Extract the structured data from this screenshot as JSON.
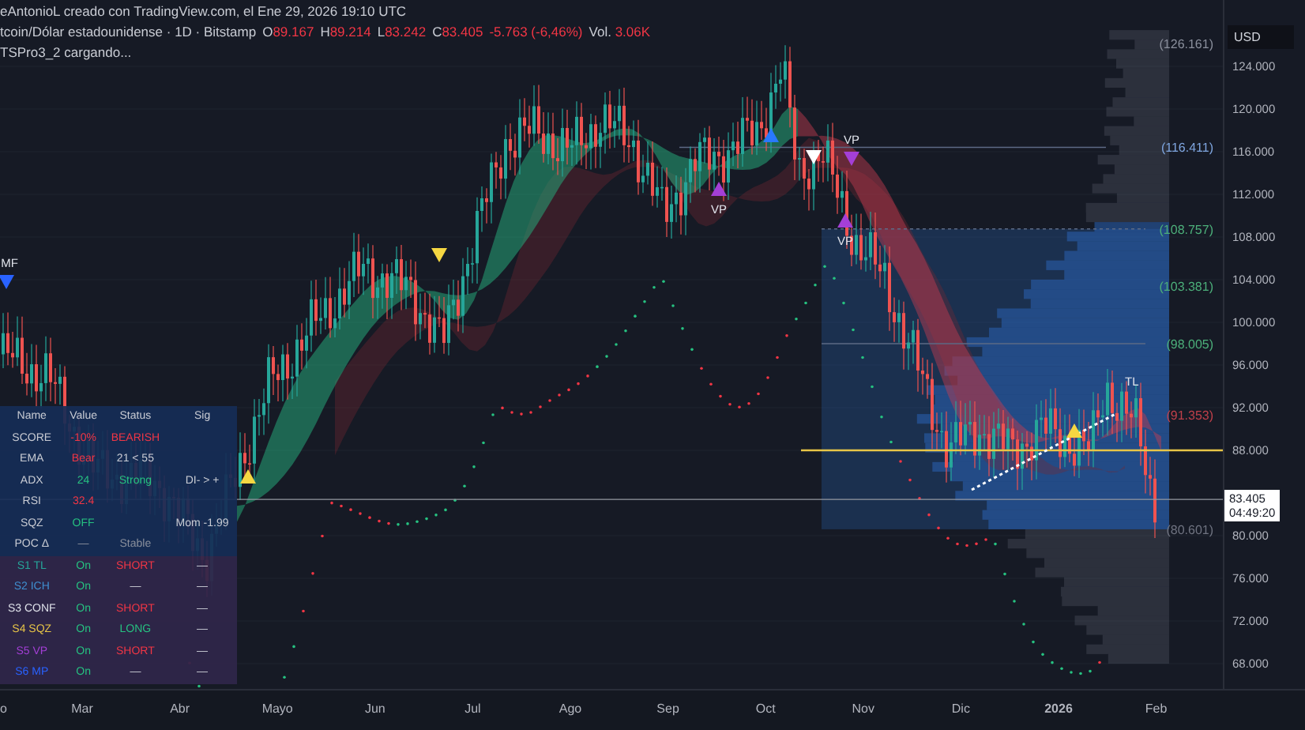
{
  "attribution": "eAntonioL creado con TradingView.com, el Ene 29, 2026 19:10 UTC",
  "symbol": {
    "name": "tcoin/Dólar estadounidense · 1D · Bitstamp",
    "ohlc": [
      {
        "key": "O",
        "value": "89.167"
      },
      {
        "key": "H",
        "value": "89.214"
      },
      {
        "key": "L",
        "value": "83.242"
      },
      {
        "key": "C",
        "value": "83.405"
      }
    ],
    "change": "-5.763 (-6,46%)",
    "volume_label": "Vol.",
    "volume": "3.06K"
  },
  "indicator_status": "TSPro3_2 cargando...",
  "price_axis": {
    "currency": "USD",
    "ticks": [
      "124.000",
      "120.000",
      "116.000",
      "112.000",
      "108.000",
      "104.000",
      "100.000",
      "96.000",
      "92.000",
      "88.000",
      "80.000",
      "76.000",
      "72.000",
      "68.000"
    ],
    "last_price": "83.405",
    "countdown": "04:49:20"
  },
  "levels": [
    {
      "text": "(126.161)",
      "color": "#8a8f9c"
    },
    {
      "text": "(116.411)",
      "color": "#7fa6e0"
    },
    {
      "text": "(108.757)",
      "color": "#4caf7a"
    },
    {
      "text": "(103.381)",
      "color": "#4caf7a"
    },
    {
      "text": "(98.005)",
      "color": "#4caf7a"
    },
    {
      "text": "(91.353)",
      "color": "#c0404a"
    },
    {
      "text": "(80.601)",
      "color": "#6f7380"
    }
  ],
  "markers": [
    {
      "kind": "down",
      "color": "#2962ff",
      "label": "MF"
    },
    {
      "kind": "up",
      "color": "#f5d742"
    },
    {
      "kind": "down",
      "color": "#f5d742"
    },
    {
      "kind": "up",
      "color": "#a43fd6",
      "label": "VP"
    },
    {
      "kind": "up",
      "color": "#2979ff"
    },
    {
      "kind": "down",
      "color": "#ffffff"
    },
    {
      "kind": "down",
      "color": "#a43fd6",
      "label": "VP"
    },
    {
      "kind": "up",
      "color": "#a43fd6",
      "label": "VP"
    },
    {
      "kind": "up",
      "color": "#f5d742"
    }
  ],
  "trendline": {
    "label": "TL"
  },
  "time_axis": [
    "o",
    "Mar",
    "Abr",
    "Mayo",
    "Jun",
    "Jul",
    "Ago",
    "Sep",
    "Oct",
    "Nov",
    "Dic",
    "2026",
    "Feb"
  ],
  "table": {
    "columns": [
      "Name",
      "Value",
      "Status",
      "Sig"
    ],
    "rows": [
      {
        "name": {
          "text": "SCORE"
        },
        "value": {
          "text": "-10%",
          "color": "#f23645"
        },
        "status": {
          "text": "BEARISH",
          "color": "#f23645"
        }
      },
      {
        "name": {
          "text": "EMA"
        },
        "value": {
          "text": "Bear",
          "color": "#f23645"
        },
        "status": {
          "text": "21 < 55"
        }
      },
      {
        "name": {
          "text": "ADX"
        },
        "value": {
          "text": "24",
          "color": "#26c281"
        },
        "status": {
          "text": "Strong",
          "color": "#26c281"
        },
        "sig": {
          "text": "DI- > +"
        }
      },
      {
        "name": {
          "text": "RSI"
        },
        "value": {
          "text": "32.4",
          "color": "#f23645"
        }
      },
      {
        "name": {
          "text": "SQZ"
        },
        "value": {
          "text": "OFF",
          "color": "#26c281"
        },
        "sig": {
          "text": "Mom -1.99"
        }
      },
      {
        "name": {
          "text": "POC Δ"
        },
        "value": {
          "text": "—"
        },
        "status": {
          "text": "Stable",
          "color": "#8a8f9c"
        }
      },
      {
        "name": {
          "text": "S1 TL",
          "color": "#26a69a"
        },
        "value": {
          "text": "On",
          "color": "#26c281"
        },
        "status": {
          "text": "SHORT",
          "color": "#f23645"
        },
        "sig": {
          "text": "—"
        }
      },
      {
        "name": {
          "text": "S2 ICH",
          "color": "#3f8fd0"
        },
        "value": {
          "text": "On",
          "color": "#26c281"
        },
        "status": {
          "text": "—"
        },
        "sig": {
          "text": "—"
        }
      },
      {
        "name": {
          "text": "S3 CONF",
          "color": "#e0e3eb"
        },
        "value": {
          "text": "On",
          "color": "#26c281"
        },
        "status": {
          "text": "SHORT",
          "color": "#f23645"
        },
        "sig": {
          "text": "—"
        }
      },
      {
        "name": {
          "text": "S4 SQZ",
          "color": "#e8c547"
        },
        "value": {
          "text": "On",
          "color": "#26c281"
        },
        "status": {
          "text": "LONG",
          "color": "#26c281"
        },
        "sig": {
          "text": "—"
        }
      },
      {
        "name": {
          "text": "S5 VP",
          "color": "#a43fd6"
        },
        "value": {
          "text": "On",
          "color": "#26c281"
        },
        "status": {
          "text": "SHORT",
          "color": "#f23645"
        },
        "sig": {
          "text": "—"
        }
      },
      {
        "name": {
          "text": "S6 MP",
          "color": "#2962ff"
        },
        "value": {
          "text": "On",
          "color": "#26c281"
        },
        "status": {
          "text": "—"
        },
        "sig": {
          "text": "—"
        }
      }
    ]
  }
}
